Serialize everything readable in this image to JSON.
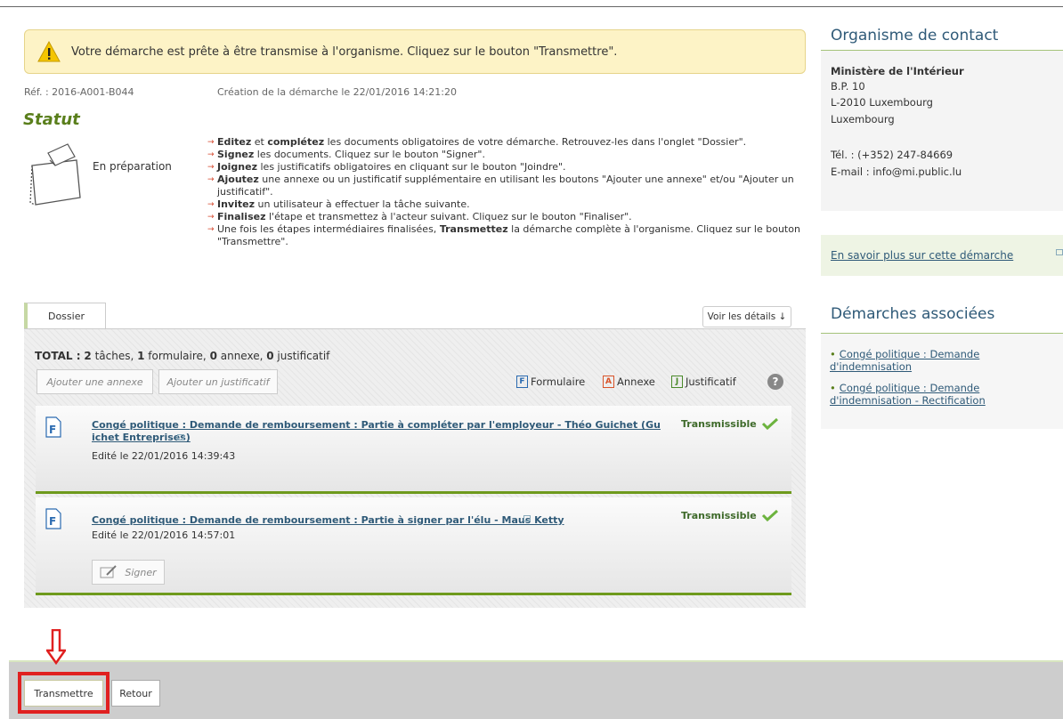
{
  "notice": {
    "text": "Votre démarche est prête à être transmise à l'organisme. Cliquez sur le bouton \"Transmettre\"."
  },
  "meta": {
    "ref": "Réf. : 2016-A001-B044",
    "created": "Création de la démarche le 22/01/2016 14:21:20"
  },
  "status": {
    "title": "Statut",
    "value": "En préparation"
  },
  "steps": [
    {
      "bold": "Editez",
      "mid": " et ",
      "bold2": "complétez",
      "rest": " les documents obligatoires de votre démarche. Retrouvez-les dans l'onglet \"Dossier\"."
    },
    {
      "bold": "Signez",
      "rest": " les documents. Cliquez sur le bouton \"Signer\"."
    },
    {
      "bold": "Joignez",
      "rest": " les justificatifs obligatoires en cliquant sur le bouton \"Joindre\"."
    },
    {
      "bold": "Ajoutez",
      "rest": " une annexe ou un justificatif supplémentaire en utilisant les boutons \"Ajouter une annexe\" et/ou \"Ajouter un justificatif\"."
    },
    {
      "bold": "Invitez",
      "rest": " un utilisateur à effectuer la tâche suivante."
    },
    {
      "bold": "Finalisez",
      "rest": " l'étape et transmettez à l'acteur suivant. Cliquez sur le bouton \"Finaliser\"."
    },
    {
      "pre": "Une fois les étapes intermédiaires finalisées, ",
      "bold": "Transmettez",
      "rest": " la démarche complète à l'organisme. Cliquez sur le bouton \"Transmettre\"."
    }
  ],
  "contact": {
    "title": "Organisme de contact",
    "name": "Ministère de l'Intérieur",
    "address": [
      "B.P. 10",
      "L-2010 Luxembourg",
      "Luxembourg"
    ],
    "phone": "Tél. : (+352) 247-84669",
    "email": "E-mail : info@mi.public.lu",
    "more_link": "En savoir plus sur cette démarche"
  },
  "associated": {
    "title": "Démarches associées",
    "items": [
      "Congé politique : Demande d'indemnisation",
      "Congé politique : Demande d'indemnisation - Rectification"
    ]
  },
  "dossier": {
    "tab": "Dossier",
    "details_button": "Voir les détails ↓",
    "total": {
      "label": "TOTAL :",
      "tasks_n": "2",
      "tasks": " tâches, ",
      "forms_n": "1",
      "forms": " formulaire, ",
      "annex_n": "0",
      "annex": " annexe, ",
      "just_n": "0",
      "just": " justificatif"
    },
    "add_annex": "Ajouter une annexe",
    "add_justif": "Ajouter un justificatif",
    "legend": {
      "form": "Formulaire",
      "annex": "Annexe",
      "justif": "Justificatif"
    },
    "tasks": [
      {
        "title": "Congé politique : Demande de remboursement : Partie à compléter par l'employeur - Théo Guichet (Gu",
        "title2": "ichet Entreprises)",
        "edited": "Edité le 22/01/2016 14:39:43",
        "state": "Transmissible"
      },
      {
        "title": "Congé politique : Demande de remboursement : Partie à signer par l'élu - Maus Ketty",
        "edited": "Edité le 22/01/2016 14:57:01",
        "state": "Transmissible",
        "sign": "Signer"
      }
    ]
  },
  "footer": {
    "transmit": "Transmettre",
    "back": "Retour"
  },
  "colors": {
    "accent": "#5a7f1c",
    "link": "#2f5a78",
    "highlight": "#e02020",
    "notice_bg": "#fdf3c6"
  }
}
